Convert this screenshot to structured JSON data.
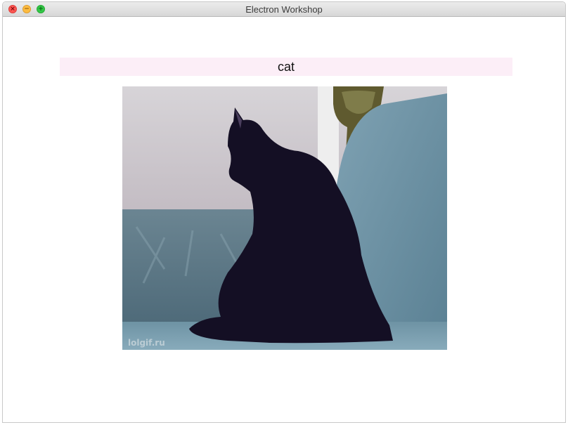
{
  "window": {
    "title": "Electron Workshop",
    "buttons": {
      "close_glyph": "×",
      "minimize_glyph": "−",
      "maximize_glyph": "+"
    }
  },
  "content": {
    "heading": "cat",
    "image": {
      "description_icon": "cat-gif",
      "watermark": "lolgif.ru"
    }
  },
  "colors": {
    "heading_bg": "#fceef7",
    "close": "#fc5753",
    "minimize": "#fdbc40",
    "maximize": "#33c748"
  }
}
